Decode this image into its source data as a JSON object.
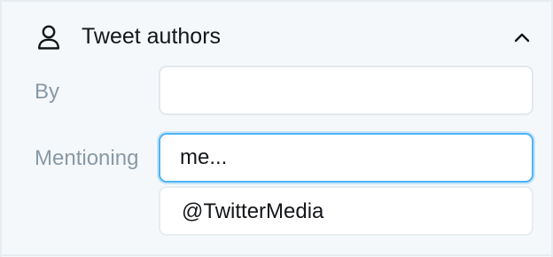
{
  "section": {
    "title": "Tweet authors",
    "icon": "user-icon",
    "collapse_icon": "chevron-up-icon"
  },
  "by": {
    "label": "By",
    "value": "",
    "placeholder": ""
  },
  "mentioning": {
    "label": "Mentioning",
    "value": "me...",
    "focused": true
  },
  "suggestions": [
    {
      "label": "@TwitterMedia"
    }
  ],
  "colors": {
    "panel_bg": "#f5f8fa",
    "text": "#14171a",
    "label": "#8899a6",
    "focus_border": "#4fb3f5",
    "field_border": "#e1e8ed"
  }
}
